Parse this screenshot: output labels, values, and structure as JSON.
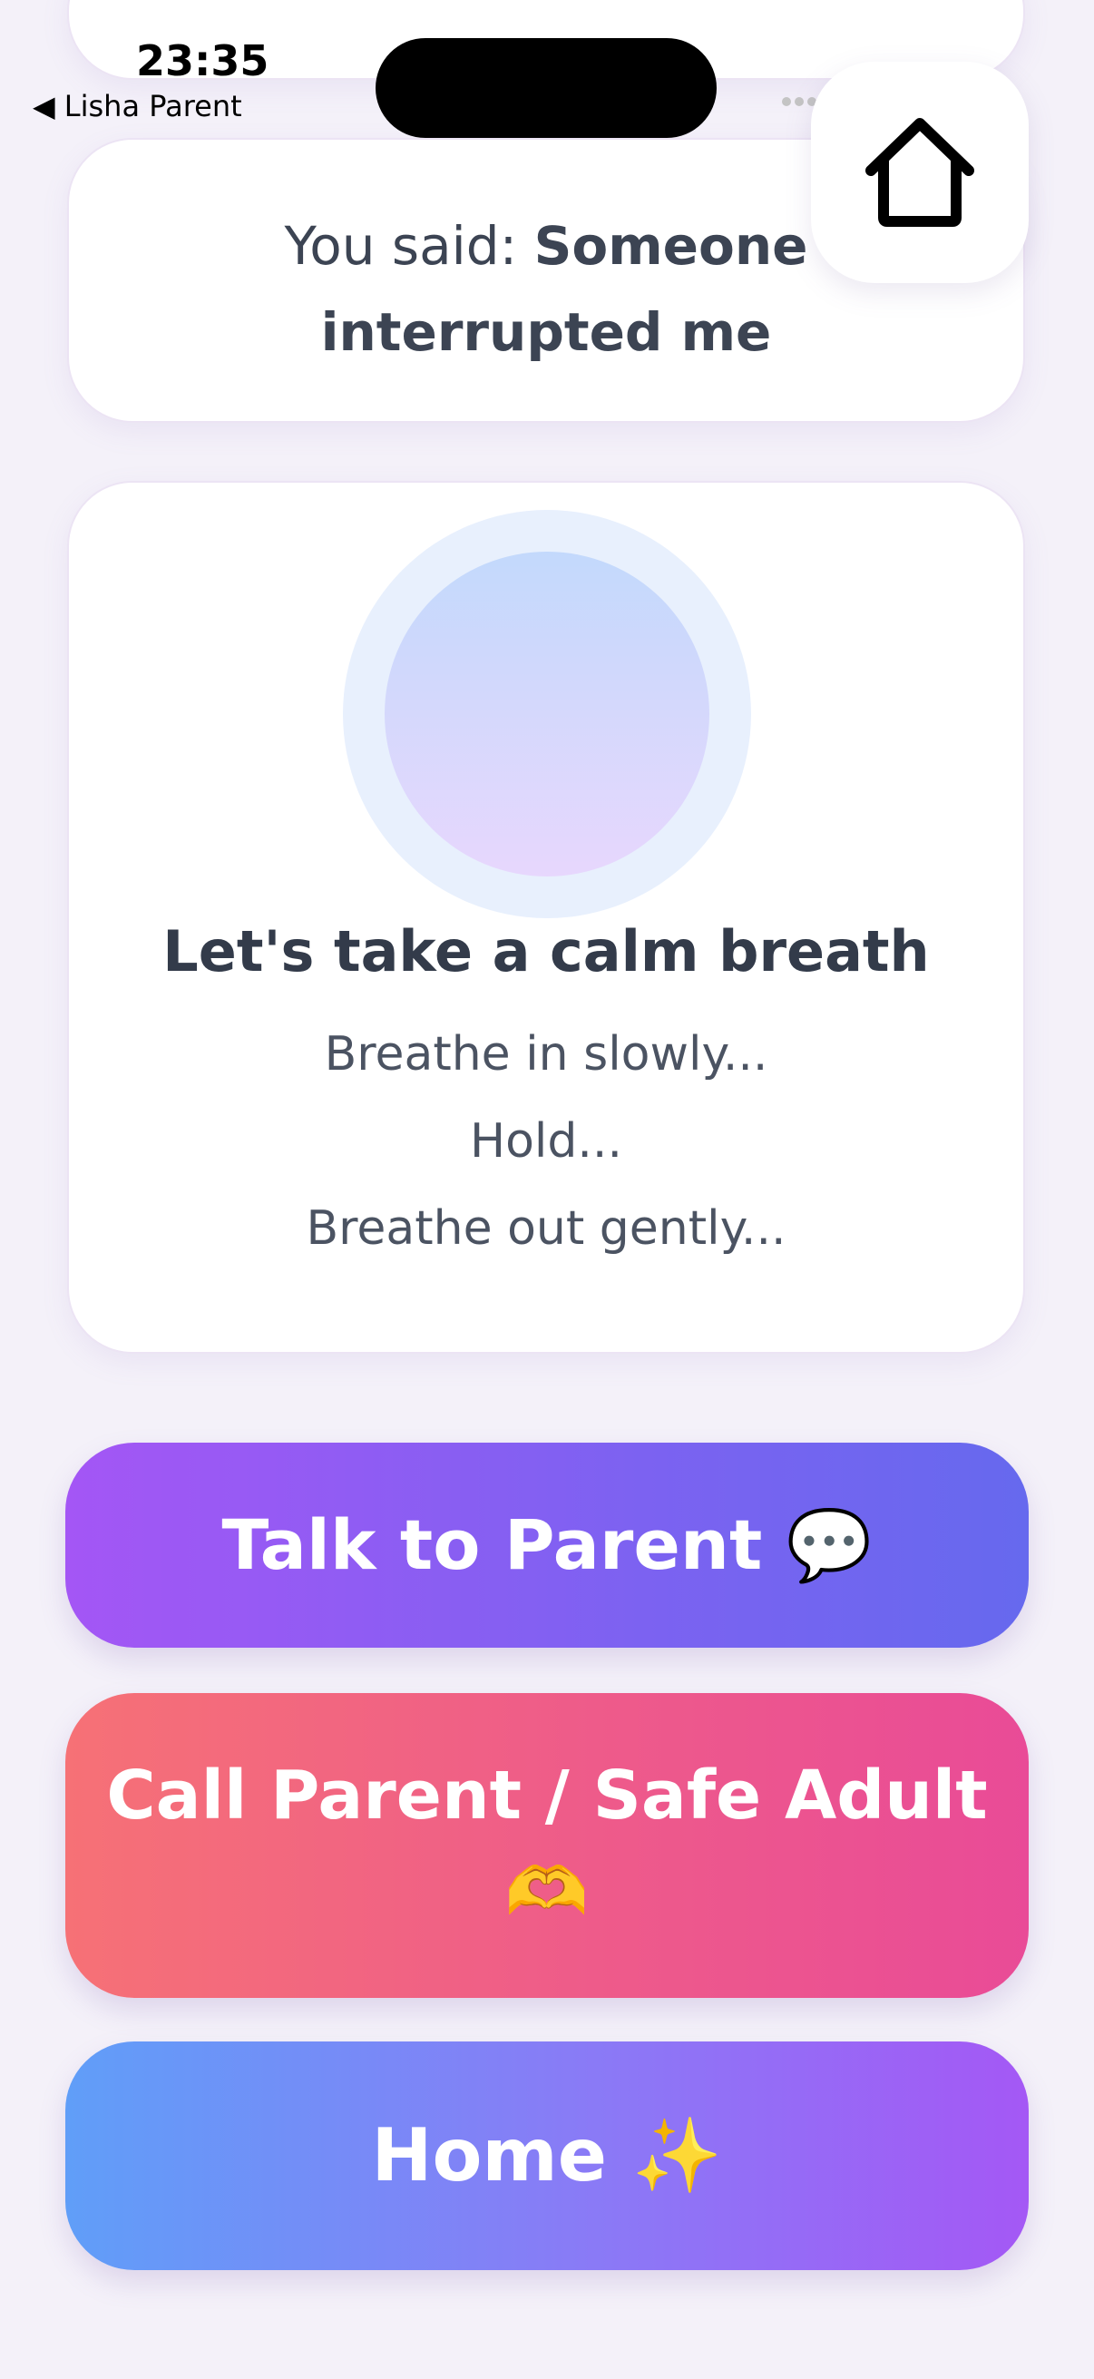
{
  "status_bar": {
    "time": "23:35",
    "back_label": "◀ Lisha Parent"
  },
  "said_card": {
    "prefix": "You said: ",
    "bold_line1": "Someone",
    "bold_line2": "interrupted me"
  },
  "breath_card": {
    "title": "Let's take a calm breath",
    "lines": [
      "Breathe in slowly...",
      "Hold...",
      "Breathe out gently..."
    ]
  },
  "buttons": {
    "talk": "Talk to Parent 💬",
    "call_line1": "Call Parent / Safe Adult",
    "call_line2": "🫶",
    "home": "Home ✨"
  },
  "icons": {
    "home_fab": "home-icon",
    "wifi": "wifi-icon",
    "battery": "battery-icon"
  },
  "colors": {
    "background": "#f4f1f9",
    "talk_gradient": [
      "#a456f5",
      "#6669ee"
    ],
    "call_gradient": [
      "#f67176",
      "#e94b97"
    ],
    "home_gradient": [
      "#609ef8",
      "#a458f5"
    ]
  }
}
